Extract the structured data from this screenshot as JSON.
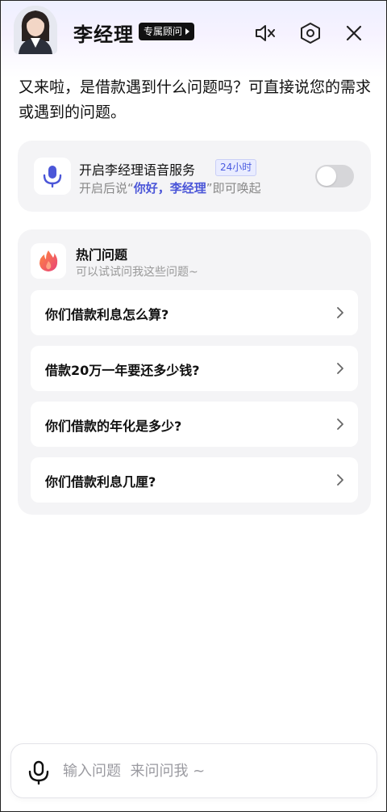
{
  "header": {
    "name": "李经理",
    "badge": "专属顾问",
    "icons": [
      "mute-icon",
      "settings-hex-icon",
      "close-icon"
    ]
  },
  "greeting": "又来啦，是借款遇到什么问题吗？可直接说您的需求或遇到的问题。",
  "voice_service": {
    "title": "开启李经理语音服务",
    "tag": "24小时",
    "sub_prefix": "开启后说“",
    "sub_highlight": "你好，李经理",
    "sub_suffix": "”即可唤起",
    "toggle_on": false,
    "accent": "#4b56d8"
  },
  "hot_questions": {
    "title": "热门问题",
    "subtitle": "可以试试问我这些问题~",
    "items": [
      {
        "label": "你们借款利息怎么算?"
      },
      {
        "label": "借款20万一年要还多少钱?"
      },
      {
        "label": "你们借款的年化是多少?"
      },
      {
        "label": "你们借款利息几厘?"
      }
    ]
  },
  "input": {
    "placeholder": "输入问题  来问问我 ~"
  }
}
